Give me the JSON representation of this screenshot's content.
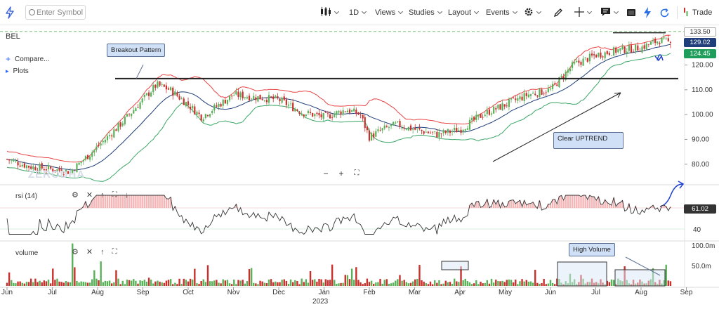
{
  "toolbar": {
    "search_placeholder": "Enter Symbol",
    "interval": "1D",
    "views": "Views",
    "studies": "Studies",
    "layout": "Layout",
    "events": "Events",
    "trade": "Trade"
  },
  "chart": {
    "symbol": "BEL",
    "compare_label": "Compare...",
    "plots_label": "Plots",
    "rsi_label": "rsi (14)",
    "volume_label": "volume",
    "watermark": "ZERODHA",
    "year_label": "2023"
  },
  "annotations": {
    "breakout": "Breakout Pattern",
    "uptrend": "Clear UPTREND",
    "high_volume": "High Volume"
  },
  "axis_tags": {
    "high": "133.50",
    "last": "129.02",
    "low": "124.45",
    "rsi": "61.02"
  },
  "colors": {
    "up": "#59b159",
    "down": "#c9302c",
    "bb_upper": "#e84444",
    "bb_lower": "#3aa665",
    "bb_mid": "#1f3e7a",
    "rsi_line": "#333333",
    "rsi_fill": "#f4b6b6",
    "resistance": "#222222",
    "trendline": "#222222",
    "pen": "#1b3fd1",
    "last_tag": "#1f3e7a",
    "low_tag": "#1f9e5b"
  },
  "chart_data": {
    "type": "candlestick",
    "x_ticks": [
      "Jun",
      "Jul",
      "Aug",
      "Sep",
      "Oct",
      "Nov",
      "Dec",
      "Jan",
      "Feb",
      "Mar",
      "Apr",
      "May",
      "Jun",
      "Jul",
      "Aug",
      "Sep"
    ],
    "year_marker": "2023",
    "price_axis": {
      "ticks": [
        80.0,
        90.0,
        100.0,
        110.0,
        120.0
      ],
      "range": [
        72,
        136
      ]
    },
    "rsi_axis": {
      "ticks": [
        40
      ],
      "range": [
        30,
        80
      ],
      "overbought": 60,
      "oversold": 40,
      "last": 61.02
    },
    "volume_axis": {
      "ticks": [
        "50.0m",
        "100.0m"
      ],
      "range_m": [
        0,
        105
      ]
    },
    "price_path_anchors": {
      "x_month_index": [
        0,
        0.5,
        1.0,
        1.4,
        2.0,
        2.5,
        3.0,
        3.3,
        3.6,
        4.0,
        4.3,
        4.6,
        5.0,
        5.5,
        6.0,
        6.5,
        7.0,
        7.5,
        7.8,
        8.0,
        8.3,
        8.6,
        9.0,
        9.5,
        10.0,
        10.5,
        11.0,
        11.5,
        12.0,
        12.5,
        13.0,
        13.5,
        14.0,
        14.4,
        14.65
      ],
      "close": [
        82,
        79,
        78,
        77,
        87,
        96,
        106,
        112,
        110,
        104,
        99,
        103,
        108,
        107,
        106,
        101,
        99,
        102,
        100,
        91,
        94,
        96,
        94,
        92,
        94,
        100,
        104,
        108,
        110,
        120,
        124,
        126,
        127,
        130,
        129
      ]
    },
    "bollinger": {
      "period": 20,
      "stddev": 2
    },
    "resistance_level": 114.5,
    "recent_high_level": 133.5,
    "last_close": 129.02,
    "last_low": 124.45
  }
}
